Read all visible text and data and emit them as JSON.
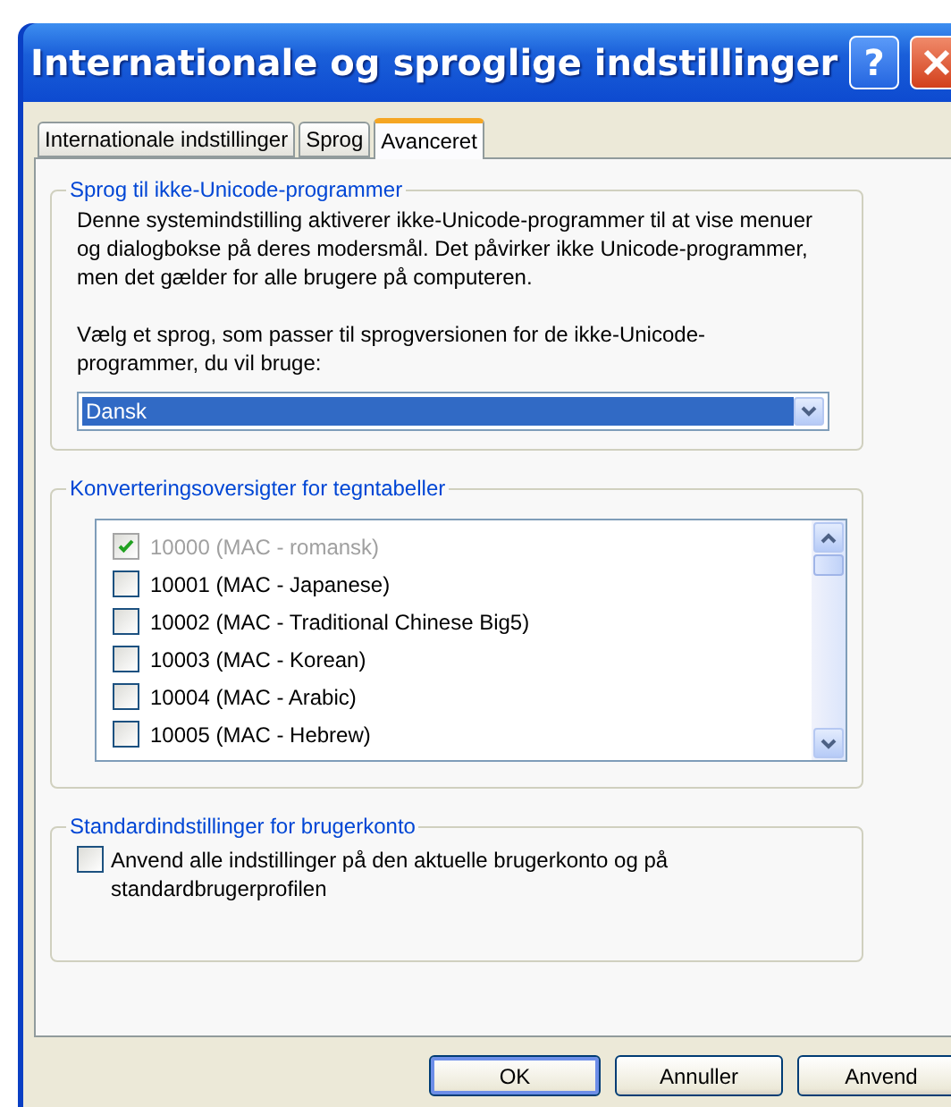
{
  "window": {
    "title": "Internationale og sproglige indstillinger",
    "help_button": "?"
  },
  "tabs": [
    {
      "label": "Internationale indstillinger",
      "selected": false
    },
    {
      "label": "Sprog",
      "selected": false
    },
    {
      "label": "Avanceret",
      "selected": true
    }
  ],
  "non_unicode": {
    "legend": "Sprog til ikke-Unicode-programmer",
    "description": "Denne systemindstilling aktiverer ikke-Unicode-programmer til at vise menuer og dialogbokse på deres modersmål. Det påvirker ikke Unicode-programmer, men det gælder for alle brugere på computeren.",
    "prompt": "Vælg et sprog, som passer til sprogversionen for de ikke-Unicode-programmer, du vil bruge:",
    "language": "Dansk"
  },
  "code_pages": {
    "legend": "Konverteringsoversigter for tegntabeller",
    "items": [
      {
        "label": "10000 (MAC - romansk)",
        "checked": true,
        "disabled": true
      },
      {
        "label": "10001 (MAC - Japanese)",
        "checked": false,
        "disabled": false
      },
      {
        "label": "10002 (MAC - Traditional Chinese Big5)",
        "checked": false,
        "disabled": false
      },
      {
        "label": "10003 (MAC - Korean)",
        "checked": false,
        "disabled": false
      },
      {
        "label": "10004 (MAC - Arabic)",
        "checked": false,
        "disabled": false
      },
      {
        "label": "10005 (MAC - Hebrew)",
        "checked": false,
        "disabled": false
      }
    ]
  },
  "user_account": {
    "legend": "Standardindstillinger for brugerkonto",
    "option": {
      "label": "Anvend alle indstillinger på den aktuelle brugerkonto og på standardbrugerprofilen",
      "checked": false
    }
  },
  "buttons": [
    {
      "label": "OK",
      "default": true
    },
    {
      "label": "Annuller",
      "default": false
    },
    {
      "label": "Anvend",
      "default": false
    }
  ]
}
